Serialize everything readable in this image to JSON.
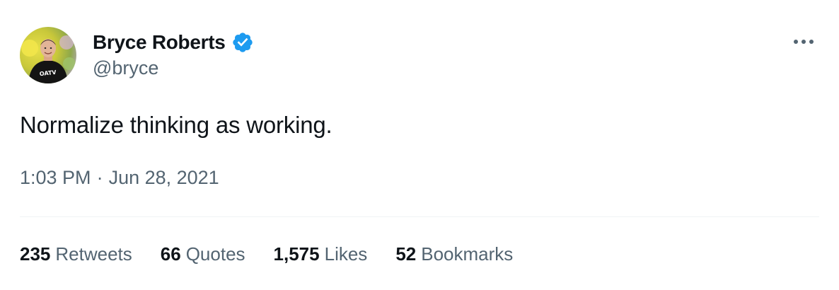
{
  "author": {
    "display_name": "Bryce Roberts",
    "handle": "@bryce",
    "verified": true,
    "avatar_shirt_text": "OATV"
  },
  "tweet": {
    "text": "Normalize thinking as working.",
    "time": "1:03 PM",
    "separator": "·",
    "date": "Jun 28, 2021"
  },
  "stats": [
    {
      "value": "235",
      "label": "Retweets"
    },
    {
      "value": "66",
      "label": "Quotes"
    },
    {
      "value": "1,575",
      "label": "Likes"
    },
    {
      "value": "52",
      "label": "Bookmarks"
    }
  ],
  "icons": {
    "verified": "verified-badge-icon",
    "more": "more-dots-icon"
  },
  "colors": {
    "text_primary": "#0f1419",
    "text_secondary": "#536471",
    "verified_blue": "#1d9bf0",
    "divider": "#eff3f4"
  }
}
